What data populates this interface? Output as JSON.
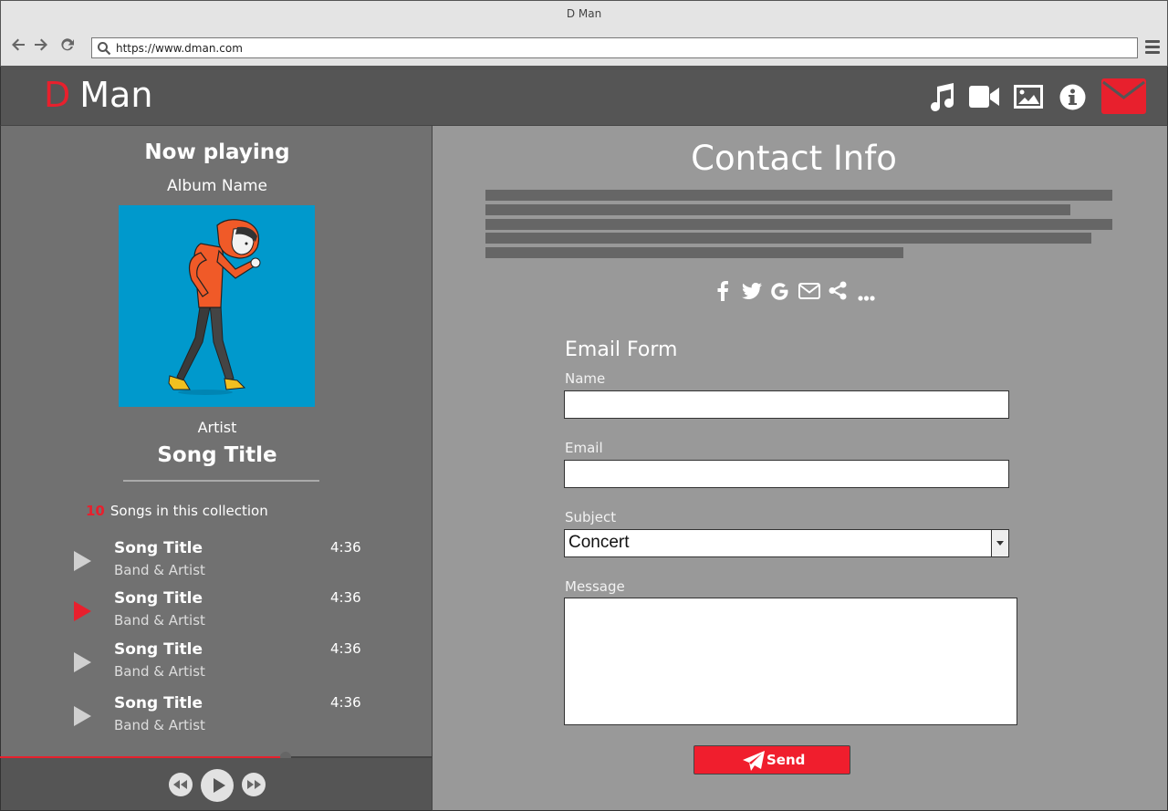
{
  "browser": {
    "window_title": "D Man",
    "url": "https://www.dman.com"
  },
  "app": {
    "logo_first": "D",
    "logo_rest": "Man",
    "nav_icons": [
      "music-icon",
      "video-icon",
      "image-icon",
      "info-icon",
      "mail-icon"
    ]
  },
  "player": {
    "heading": "Now playing",
    "album": "Album Name",
    "artist": "Artist",
    "song": "Song Title",
    "collection_count": "10",
    "collection_label": "Songs in this collection",
    "progress_fraction": 0.66,
    "tracks": [
      {
        "title": "Song Title",
        "artist": "Band & Artist",
        "duration": "4:36",
        "active": false
      },
      {
        "title": "Song Title",
        "artist": "Band & Artist",
        "duration": "4:36",
        "active": true
      },
      {
        "title": "Song Title",
        "artist": "Band & Artist",
        "duration": "4:36",
        "active": false
      },
      {
        "title": "Song Title",
        "artist": "Band & Artist",
        "duration": "4:36",
        "active": false
      }
    ]
  },
  "contact": {
    "title": "Contact Info",
    "social_icons": [
      "facebook-icon",
      "twitter-icon",
      "google-icon",
      "envelope-icon",
      "share-icon",
      "more-icon"
    ],
    "form": {
      "title": "Email Form",
      "name_label": "Name",
      "email_label": "Email",
      "subject_label": "Subject",
      "subject_value": "Concert",
      "message_label": "Message",
      "send_label": "Send"
    }
  },
  "colors": {
    "accent": "#e8202d",
    "header_bg": "#555555",
    "left_bg": "#717171",
    "right_bg": "#999999"
  }
}
